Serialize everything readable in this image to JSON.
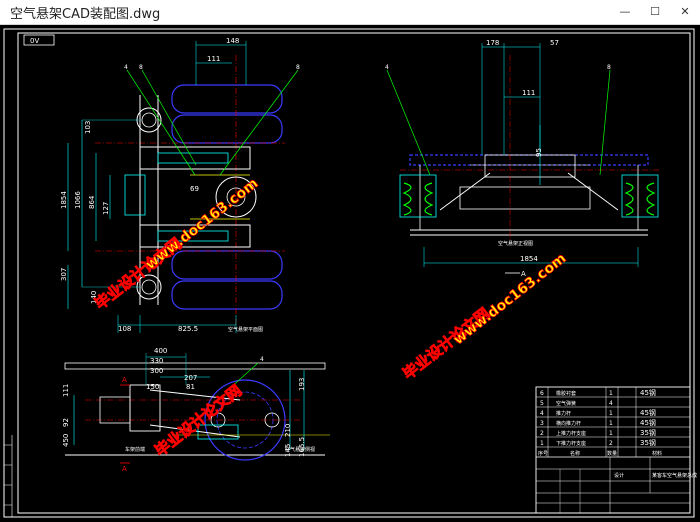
{
  "window": {
    "title": "空气悬架CAD装配图.dwg",
    "minimize_glyph": "—",
    "maximize_glyph": "☐",
    "close_glyph": "✕"
  },
  "drawing": {
    "sheet_tag": "0V",
    "top_view": {
      "dims_horizontal": [
        "148",
        "111"
      ],
      "dims_vertical": [
        "103",
        "1854",
        "1066",
        "864",
        "127",
        "307",
        "140"
      ],
      "bottom_dims": [
        "108",
        "825.5"
      ],
      "mid_dim": "69",
      "note": "空气悬架平面图"
    },
    "front_view": {
      "dims_top": [
        "178",
        "57"
      ],
      "dim_111": "111",
      "dim_side": "95",
      "width_dim": "1854",
      "view_label": "空气悬架正视图",
      "section_mark": "A"
    },
    "side_view": {
      "dims_top": [
        "400",
        "330",
        "300",
        "207",
        "150",
        "81"
      ],
      "dims_left": [
        "111",
        "92",
        "450"
      ],
      "dims_right": [
        "193",
        "210",
        "145",
        "165.5"
      ],
      "section_marks": [
        "A",
        "A"
      ],
      "label_left": "车架前端",
      "label_right": "空气悬架侧视"
    },
    "callouts": [
      "4",
      "8",
      "8",
      "4",
      "8",
      "4"
    ],
    "bom": {
      "rows": [
        {
          "no": "6",
          "name": "橡胶衬套",
          "qty": "1",
          "mat": "45钢"
        },
        {
          "no": "5",
          "name": "空气弹簧",
          "qty": "4",
          "mat": ""
        },
        {
          "no": "4",
          "name": "推力杆",
          "qty": "1",
          "mat": "45钢"
        },
        {
          "no": "3",
          "name": "横向推力杆",
          "qty": "1",
          "mat": "45钢"
        },
        {
          "no": "2",
          "name": "上推力杆支座",
          "qty": "1",
          "mat": "35钢"
        },
        {
          "no": "1",
          "name": "下推力杆支座",
          "qty": "2",
          "mat": "35钢"
        }
      ],
      "header": [
        "序号",
        "名称",
        "数量",
        "材料"
      ],
      "title_block": "某客车空气悬架总成",
      "designer_label": "设计"
    },
    "watermark": {
      "line1": "毕业设计论文网",
      "line2": "www.doc163.com"
    },
    "colors": {
      "bg": "#000000",
      "white": "#ffffff",
      "cyan": "#00ffff",
      "green": "#00ff00",
      "red": "#ff0000",
      "blue": "#3a3aff",
      "magenta": "#ff00ff",
      "yellow": "#ffff00"
    }
  }
}
